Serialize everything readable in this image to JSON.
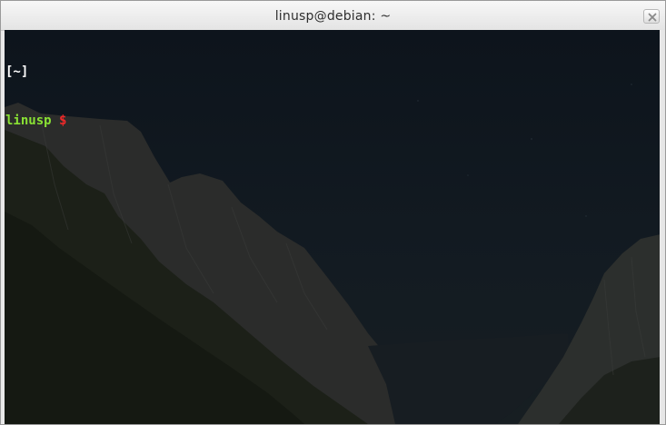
{
  "window": {
    "title": "linusp@debian: ~"
  },
  "terminal": {
    "lines": {
      "cwd": "[~]",
      "user": "linusp",
      "prompt_symbol": "$"
    }
  },
  "icons": {
    "close": "close-icon"
  },
  "colors": {
    "cwd": "#ffffff",
    "user": "#8ae234",
    "prompt": "#ef2929",
    "terminal_background": "#0e141b"
  }
}
